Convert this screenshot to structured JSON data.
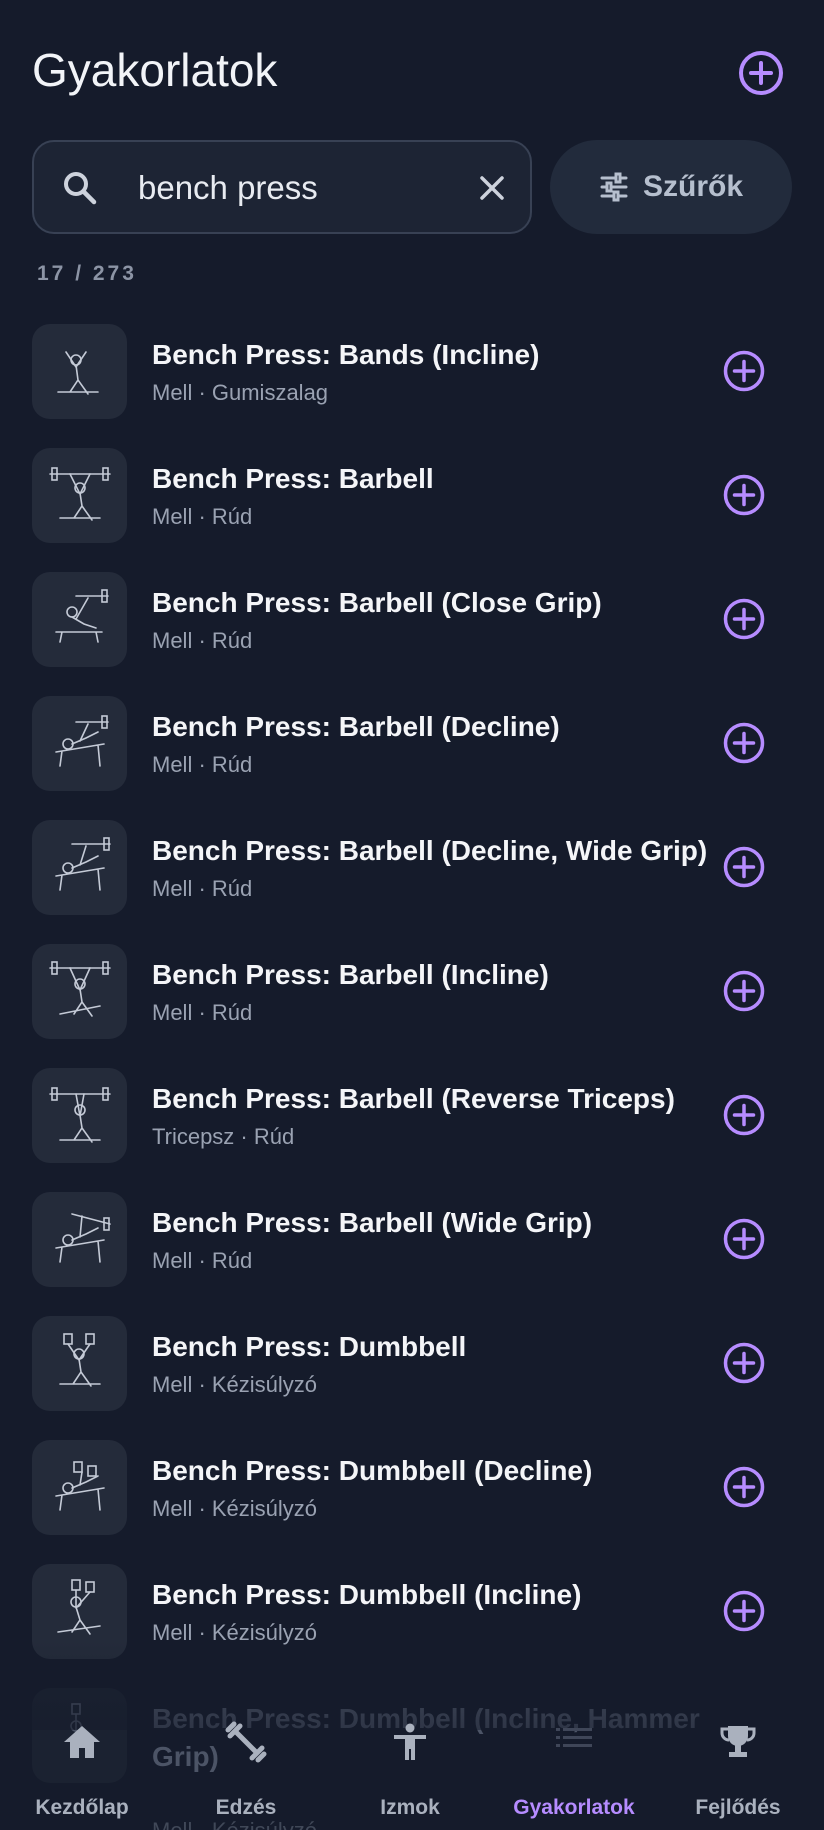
{
  "header": {
    "title": "Gyakorlatok",
    "add_icon": "add-circle-icon"
  },
  "search": {
    "value": "bench press",
    "placeholder": "",
    "search_icon": "search-icon",
    "clear_icon": "close-icon"
  },
  "filters": {
    "label": "Szűrők",
    "icon": "sliders-icon"
  },
  "result_count": "17 / 273",
  "exercises": [
    {
      "name": "Bench Press: Bands (Incline)",
      "sub": "Mell · Gumiszalag"
    },
    {
      "name": "Bench Press: Barbell",
      "sub": "Mell · Rúd"
    },
    {
      "name": "Bench Press: Barbell (Close Grip)",
      "sub": "Mell · Rúd"
    },
    {
      "name": "Bench Press: Barbell (Decline)",
      "sub": "Mell · Rúd"
    },
    {
      "name": "Bench Press: Barbell (Decline, Wide Grip)",
      "sub": "Mell · Rúd"
    },
    {
      "name": "Bench Press: Barbell (Incline)",
      "sub": "Mell · Rúd"
    },
    {
      "name": "Bench Press: Barbell (Reverse Triceps)",
      "sub": "Tricepsz · Rúd"
    },
    {
      "name": "Bench Press: Barbell (Wide Grip)",
      "sub": "Mell · Rúd"
    },
    {
      "name": "Bench Press: Dumbbell",
      "sub": "Mell · Kézisúlyzó"
    },
    {
      "name": "Bench Press: Dumbbell (Decline)",
      "sub": "Mell · Kézisúlyzó"
    },
    {
      "name": "Bench Press: Dumbbell (Incline)",
      "sub": "Mell · Kézisúlyzó"
    },
    {
      "name": "Bench Press: Dumbbell (Incline, Hammer Grip)",
      "sub": "Mell · Kézisúlyzó"
    }
  ],
  "nav": [
    {
      "label": "Kezdőlap",
      "icon": "home-icon",
      "active": false
    },
    {
      "label": "Edzés",
      "icon": "dumbbell-icon",
      "active": false
    },
    {
      "label": "Izmok",
      "icon": "person-icon",
      "active": false
    },
    {
      "label": "Gyakorlatok",
      "icon": "list-icon",
      "active": true
    },
    {
      "label": "Fejlődés",
      "icon": "trophy-icon",
      "active": false
    }
  ],
  "colors": {
    "background": "#151b2b",
    "accent": "#b68cff",
    "card": "#242b3a",
    "muted_text": "#9aa2b2"
  }
}
